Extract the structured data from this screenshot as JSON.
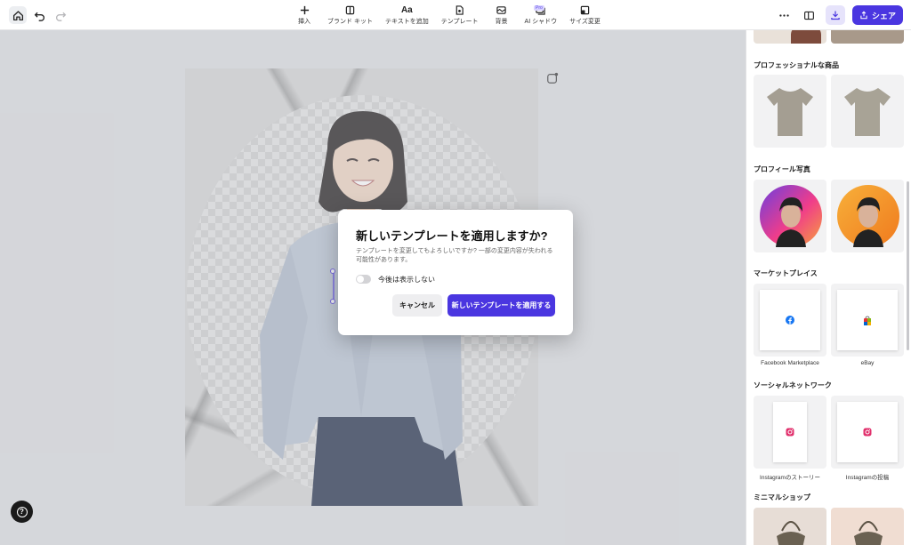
{
  "colors": {
    "accent": "#4a36e0",
    "canvas_bg": "#dcdde0",
    "panel_bg": "#ffffff"
  },
  "toolbar": {
    "tools": [
      {
        "icon": "plus-icon",
        "label": "挿入"
      },
      {
        "icon": "brand-kit-icon",
        "label": "ブランド キット"
      },
      {
        "icon": "text-icon",
        "glyph": "Aa",
        "label": "テキストを追加"
      },
      {
        "icon": "template-icon",
        "label": "テンプレート"
      },
      {
        "icon": "background-icon",
        "label": "背景"
      },
      {
        "icon": "ai-shadow-icon",
        "label": "AI シャドウ"
      },
      {
        "icon": "resize-icon",
        "label": "サイズ変更"
      }
    ],
    "pro_badge": "Pro",
    "share_label": "シェア"
  },
  "panel": {
    "sections": [
      {
        "title": "プロフェッショナルな商品",
        "items": []
      },
      {
        "title": "プロフィール写真",
        "items": []
      },
      {
        "title": "マーケットプレイス",
        "items": [
          "Facebook Marketplace",
          "eBay"
        ]
      },
      {
        "title": "ソーシャルネットワーク",
        "items": [
          "Instagramのストーリー",
          "Instagramの投稿"
        ]
      },
      {
        "title": "ミニマルショップ",
        "items": []
      }
    ]
  },
  "modal": {
    "title": "新しいテンプレートを適用しますか?",
    "description": "テンプレートを変更してもよろしいですか? 一部の変更内容が失われる可能性があります。",
    "toggle_label": "今後は表示しない",
    "toggle_on": false,
    "cancel_label": "キャンセル",
    "apply_label": "新しいテンプレートを適用する"
  }
}
